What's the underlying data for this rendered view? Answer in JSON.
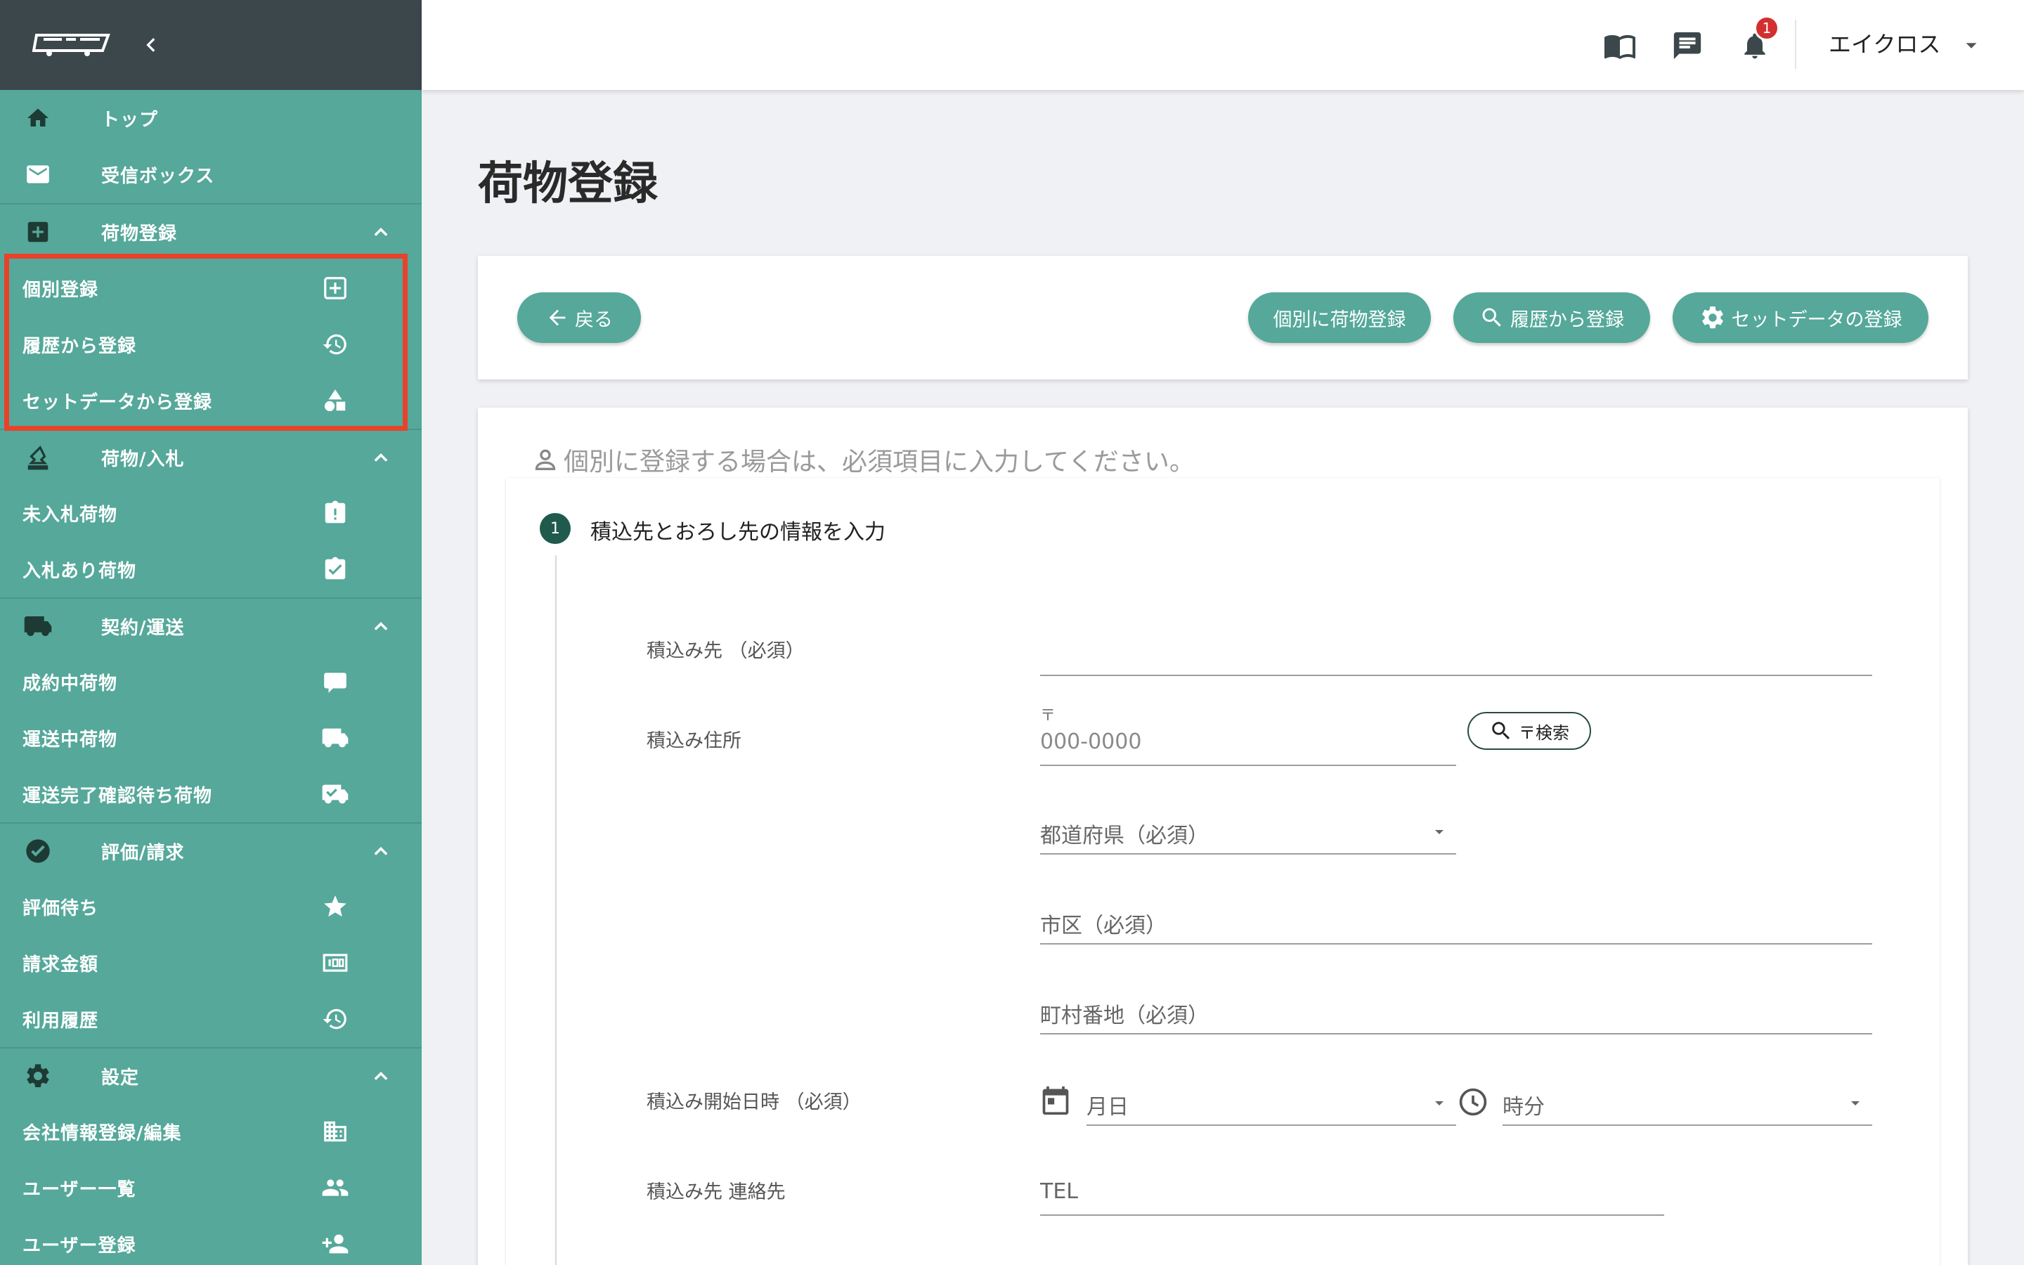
{
  "sidebar": {
    "top": "トップ",
    "inbox": "受信ボックス",
    "cargo_reg": {
      "title": "荷物登録",
      "items": [
        "個別登録",
        "履歴から登録",
        "セットデータから登録"
      ]
    },
    "cargo_bid": {
      "title": "荷物/入札",
      "items": [
        "未入札荷物",
        "入札あり荷物"
      ]
    },
    "contract": {
      "title": "契約/運送",
      "items": [
        "成約中荷物",
        "運送中荷物",
        "運送完了確認待ち荷物"
      ]
    },
    "review": {
      "title": "評価/請求",
      "items": [
        "評価待ち",
        "請求金額",
        "利用履歴"
      ]
    },
    "settings": {
      "title": "設定",
      "items": [
        "会社情報登録/編集",
        "ユーザー一覧",
        "ユーザー登録"
      ]
    }
  },
  "topbar": {
    "notification_count": "1",
    "user_name": "エイクロス"
  },
  "page": {
    "title": "荷物登録",
    "back_button": "戻る",
    "btn_individual": "個別に荷物登録",
    "btn_history": "履歴から登録",
    "btn_set": "セットデータの登録"
  },
  "form": {
    "hint": "個別に登録する場合は、必須項目に入力してください。",
    "step_number": "1",
    "step_title": "積込先とおろし先の情報を入力",
    "label_loading": "積込み先 （必須）",
    "label_address": "積込み住所",
    "zip_mark": "〒",
    "zip_placeholder": "000-0000",
    "zip_search": "〒検索",
    "prefecture": "都道府県（必須）",
    "city": "市区（必須）",
    "town": "町村番地（必須）",
    "label_start": "積込み開始日時 （必須）",
    "date_placeholder": "月日",
    "time_placeholder": "時分",
    "label_contact": "積込み先 連絡先",
    "tel_placeholder": "TEL"
  },
  "colors": {
    "sidebar": "#55a89a",
    "sidebar_header": "#3c474b",
    "accent_dark": "#1f5a4d",
    "highlight": "#e8432a",
    "badge": "#d32f2f"
  }
}
